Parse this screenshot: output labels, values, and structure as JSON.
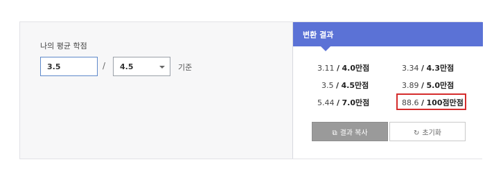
{
  "input_panel": {
    "title": "나의 평균 학점",
    "gpa_value": "3.5",
    "separator": "/",
    "scale_value": "4.5",
    "basis_label": "기준"
  },
  "result_panel": {
    "header": "변환 결과",
    "results": [
      {
        "value": "3.11",
        "scale": "4.0만점"
      },
      {
        "value": "3.34",
        "scale": "4.3만점"
      },
      {
        "value": "3.5",
        "scale": "4.5만점"
      },
      {
        "value": "3.89",
        "scale": "5.0만점"
      },
      {
        "value": "5.44",
        "scale": "7.0만점"
      },
      {
        "value": "88.6",
        "scale": "100점만점"
      }
    ],
    "highlighted_index": 5,
    "highlight_color": "#d42b2b",
    "copy_button_label": "결과 복사",
    "reset_button_label": "초기화"
  },
  "colors": {
    "header_accent": "#5b72d6",
    "copy_button": "#9a9a9a"
  },
  "icons": {
    "copy": "copy-icon",
    "reset": "refresh-icon",
    "dropdown": "chevron-down-icon"
  }
}
